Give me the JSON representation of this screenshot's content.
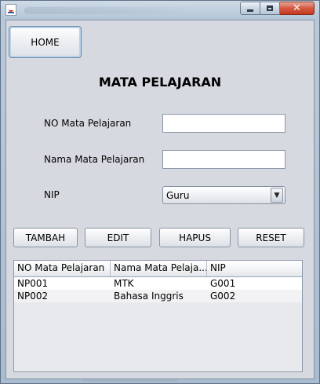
{
  "window": {
    "title": "",
    "controls": {
      "minimize": "minimize",
      "maximize": "maximize",
      "close": "✕"
    }
  },
  "nav": {
    "home_label": "HOME"
  },
  "form": {
    "heading": "MATA PELAJARAN",
    "no_label": "NO Mata Pelajaran",
    "no_value": "",
    "nama_label": "Nama Mata Pelajaran",
    "nama_value": "",
    "nip_label": "NIP",
    "nip_selected": "Guru"
  },
  "actions": {
    "tambah": "TAMBAH",
    "edit": "EDIT",
    "hapus": "HAPUS",
    "reset": "RESET"
  },
  "table": {
    "columns": [
      "NO Mata Pelajaran",
      "Nama Mata Pelaja...",
      "NIP"
    ],
    "rows": [
      [
        "NP001",
        "MTK",
        "G001"
      ],
      [
        "NP002",
        "Bahasa Inggris",
        "G002"
      ]
    ]
  },
  "colors": {
    "panel_bg": "#d6d9df",
    "row_alt": "#f2f2f4",
    "close_button": "#c23a22"
  }
}
